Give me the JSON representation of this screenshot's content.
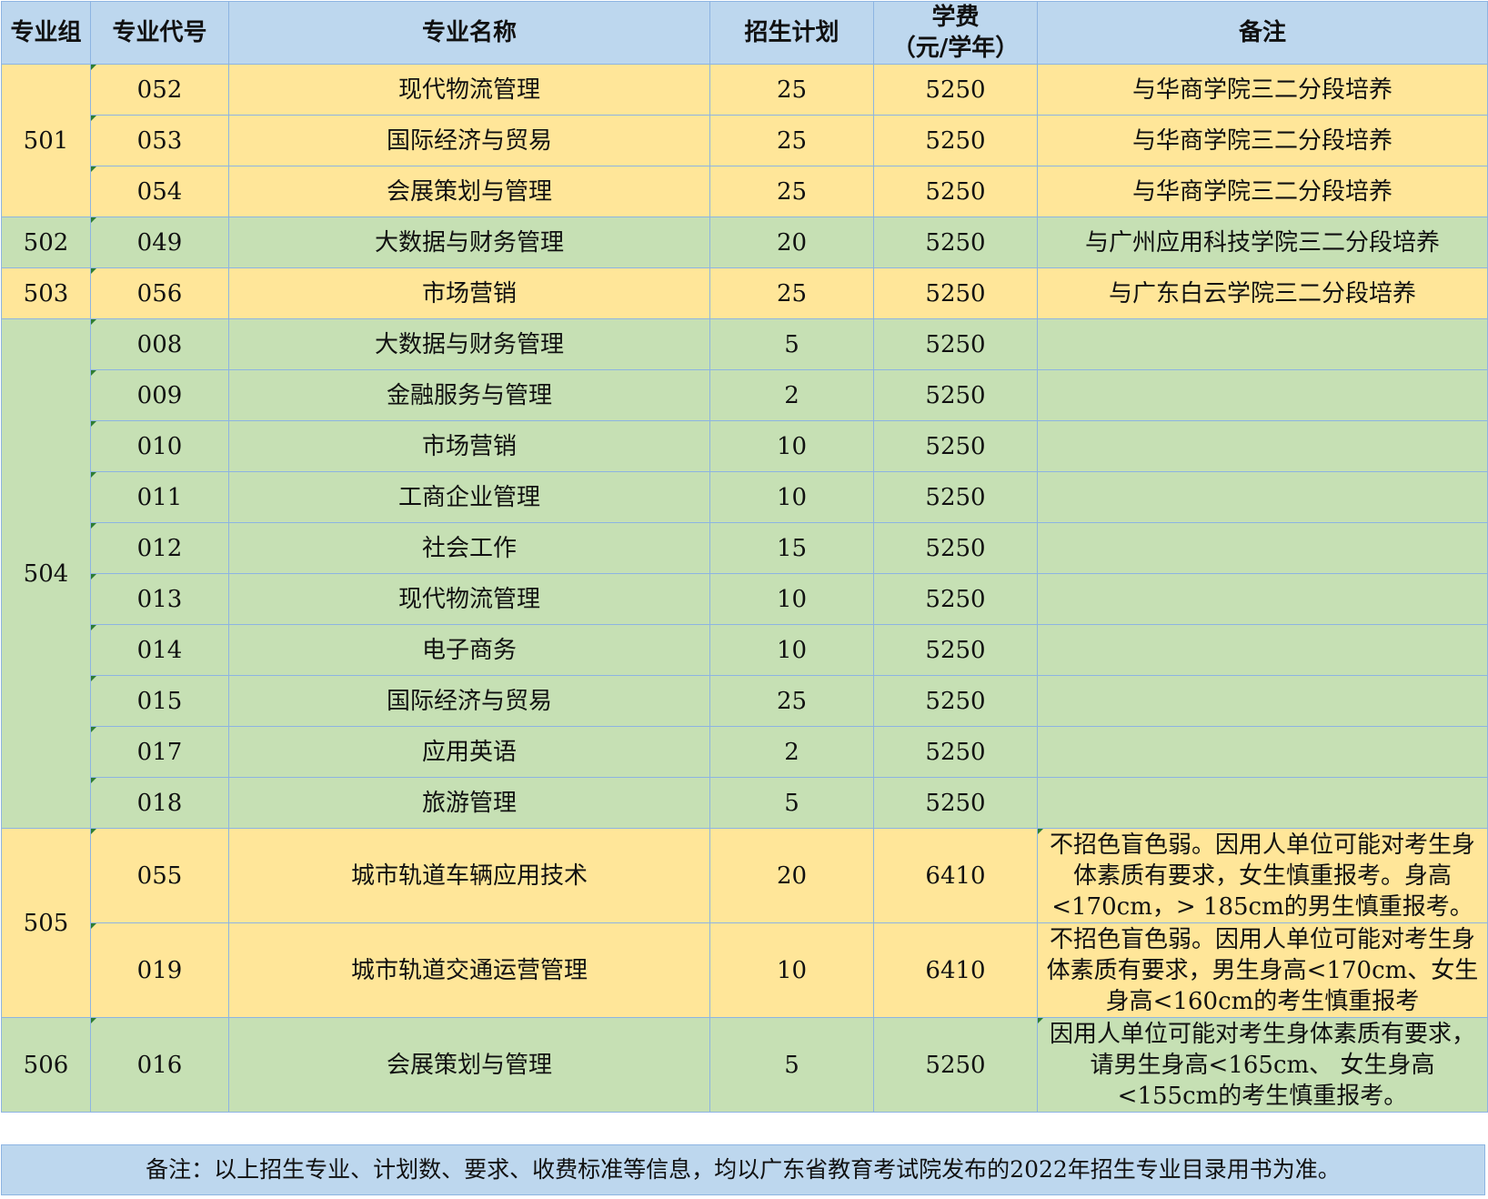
{
  "headers": {
    "group": "专业组",
    "code": "专业代号",
    "name": "专业名称",
    "plan": "招生计划",
    "fee_line1": "学费",
    "fee_line2": "（元/学年）",
    "note": "备注"
  },
  "groups": {
    "g501": "501",
    "g502": "502",
    "g503": "503",
    "g504": "504",
    "g505": "505",
    "g506": "506"
  },
  "rows": [
    {
      "code": "052",
      "name": "现代物流管理",
      "plan": "25",
      "fee": "5250",
      "note": "与华商学院三二分段培养"
    },
    {
      "code": "053",
      "name": "国际经济与贸易",
      "plan": "25",
      "fee": "5250",
      "note": "与华商学院三二分段培养"
    },
    {
      "code": "054",
      "name": "会展策划与管理",
      "plan": "25",
      "fee": "5250",
      "note": "与华商学院三二分段培养"
    },
    {
      "code": "049",
      "name": "大数据与财务管理",
      "plan": "20",
      "fee": "5250",
      "note": "与广州应用科技学院三二分段培养"
    },
    {
      "code": "056",
      "name": "市场营销",
      "plan": "25",
      "fee": "5250",
      "note": "与广东白云学院三二分段培养"
    },
    {
      "code": "008",
      "name": "大数据与财务管理",
      "plan": "5",
      "fee": "5250",
      "note": ""
    },
    {
      "code": "009",
      "name": "金融服务与管理",
      "plan": "2",
      "fee": "5250",
      "note": ""
    },
    {
      "code": "010",
      "name": "市场营销",
      "plan": "10",
      "fee": "5250",
      "note": ""
    },
    {
      "code": "011",
      "name": "工商企业管理",
      "plan": "10",
      "fee": "5250",
      "note": ""
    },
    {
      "code": "012",
      "name": "社会工作",
      "plan": "15",
      "fee": "5250",
      "note": ""
    },
    {
      "code": "013",
      "name": "现代物流管理",
      "plan": "10",
      "fee": "5250",
      "note": ""
    },
    {
      "code": "014",
      "name": "电子商务",
      "plan": "10",
      "fee": "5250",
      "note": ""
    },
    {
      "code": "015",
      "name": "国际经济与贸易",
      "plan": "25",
      "fee": "5250",
      "note": ""
    },
    {
      "code": "017",
      "name": "应用英语",
      "plan": "2",
      "fee": "5250",
      "note": ""
    },
    {
      "code": "018",
      "name": "旅游管理",
      "plan": "5",
      "fee": "5250",
      "note": ""
    },
    {
      "code": "055",
      "name": "城市轨道车辆应用技术",
      "plan": "20",
      "fee": "6410",
      "note": "不招色盲色弱。因用人单位可能对考生身体素质有要求，女生慎重报考。身高<170cm，> 185cm的男生慎重报考。"
    },
    {
      "code": "019",
      "name": "城市轨道交通运营管理",
      "plan": "10",
      "fee": "6410",
      "note": "不招色盲色弱。因用人单位可能对考生身体素质有要求，男生身高<170cm、女生身高<160cm的考生慎重报考"
    },
    {
      "code": "016",
      "name": "会展策划与管理",
      "plan": "5",
      "fee": "5250",
      "note": "因用人单位可能对考生身体素质有要求，请男生身高<165cm、 女生身高<155cm的考生慎重报考。"
    }
  ],
  "footer": "备注：以上招生专业、计划数、要求、收费标准等信息，均以广东省教育考试院发布的2022年招生专业目录用书为准。",
  "colors": {
    "header_bg": "#bdd7ee",
    "yellow_bg": "#ffe699",
    "green_bg": "#c6e0b4",
    "border": "#8db4e2"
  }
}
